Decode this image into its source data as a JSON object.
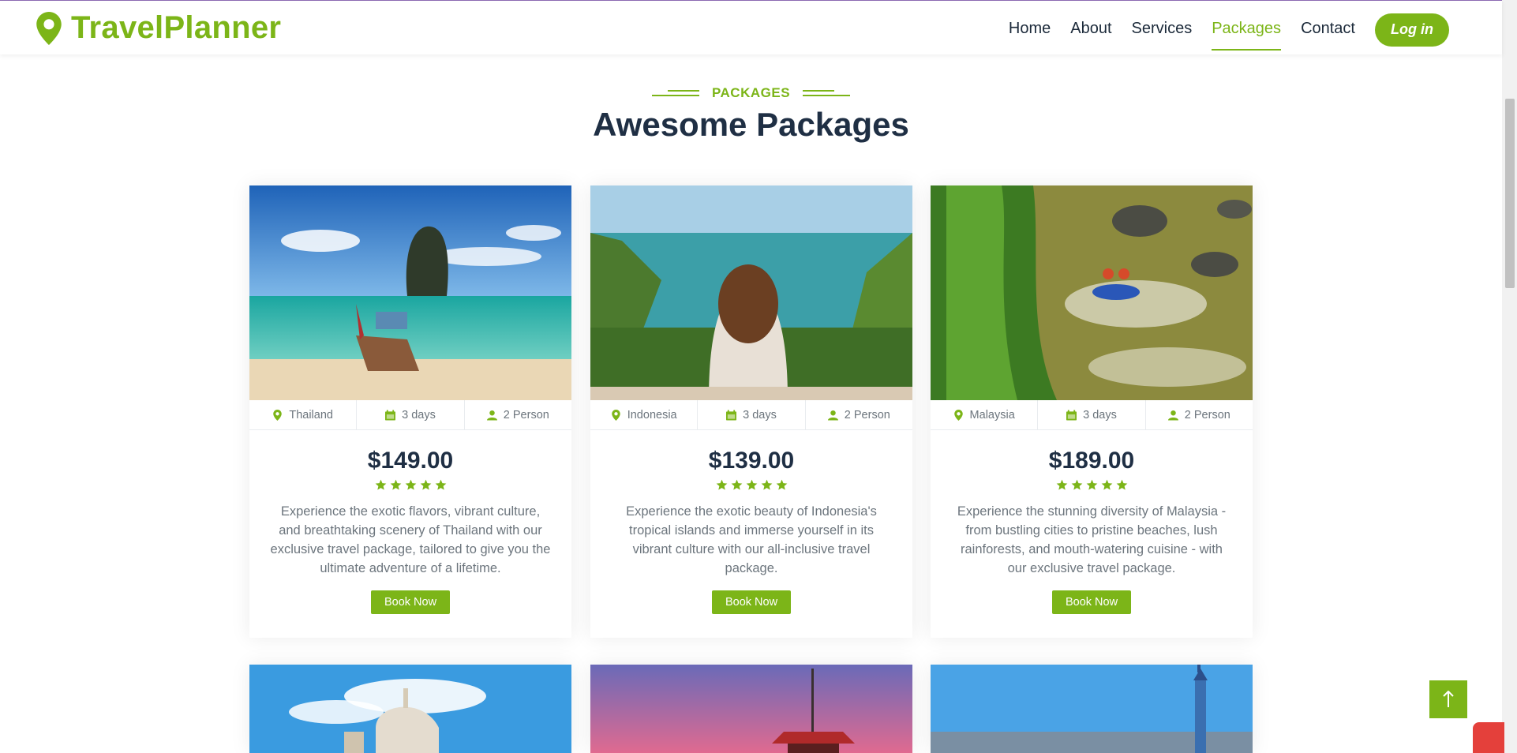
{
  "brand": {
    "name": "TravelPlanner",
    "color": "#7cb518"
  },
  "nav": {
    "items": [
      {
        "label": "Home",
        "active": false
      },
      {
        "label": "About",
        "active": false
      },
      {
        "label": "Services",
        "active": false
      },
      {
        "label": "Packages",
        "active": true
      },
      {
        "label": "Contact",
        "active": false
      }
    ],
    "login_label": "Log in"
  },
  "section": {
    "eyebrow": "PACKAGES",
    "title": "Awesome Packages"
  },
  "packages": [
    {
      "location": "Thailand",
      "duration": "3 days",
      "persons": "2 Person",
      "price": "$149.00",
      "rating": 5,
      "description": "Experience the exotic flavors, vibrant culture, and breathtaking scenery of Thailand with our exclusive travel package, tailored to give you the ultimate adventure of a lifetime.",
      "button": "Book Now"
    },
    {
      "location": "Indonesia",
      "duration": "3 days",
      "persons": "2 Person",
      "price": "$139.00",
      "rating": 5,
      "description": "Experience the exotic beauty of Indonesia's tropical islands and immerse yourself in its vibrant culture with our all-inclusive travel package.",
      "button": "Book Now"
    },
    {
      "location": "Malaysia",
      "duration": "3 days",
      "persons": "2 Person",
      "price": "$189.00",
      "rating": 5,
      "description": "Experience the stunning diversity of Malaysia - from bustling cities to pristine beaches, lush rainforests, and mouth-watering cuisine - with our exclusive travel package.",
      "button": "Book Now"
    }
  ],
  "icons": {
    "location": "map-marker-icon",
    "duration": "calendar-icon",
    "persons": "user-icon",
    "rating": "star-icon",
    "back_to_top": "arrow-up-icon"
  }
}
